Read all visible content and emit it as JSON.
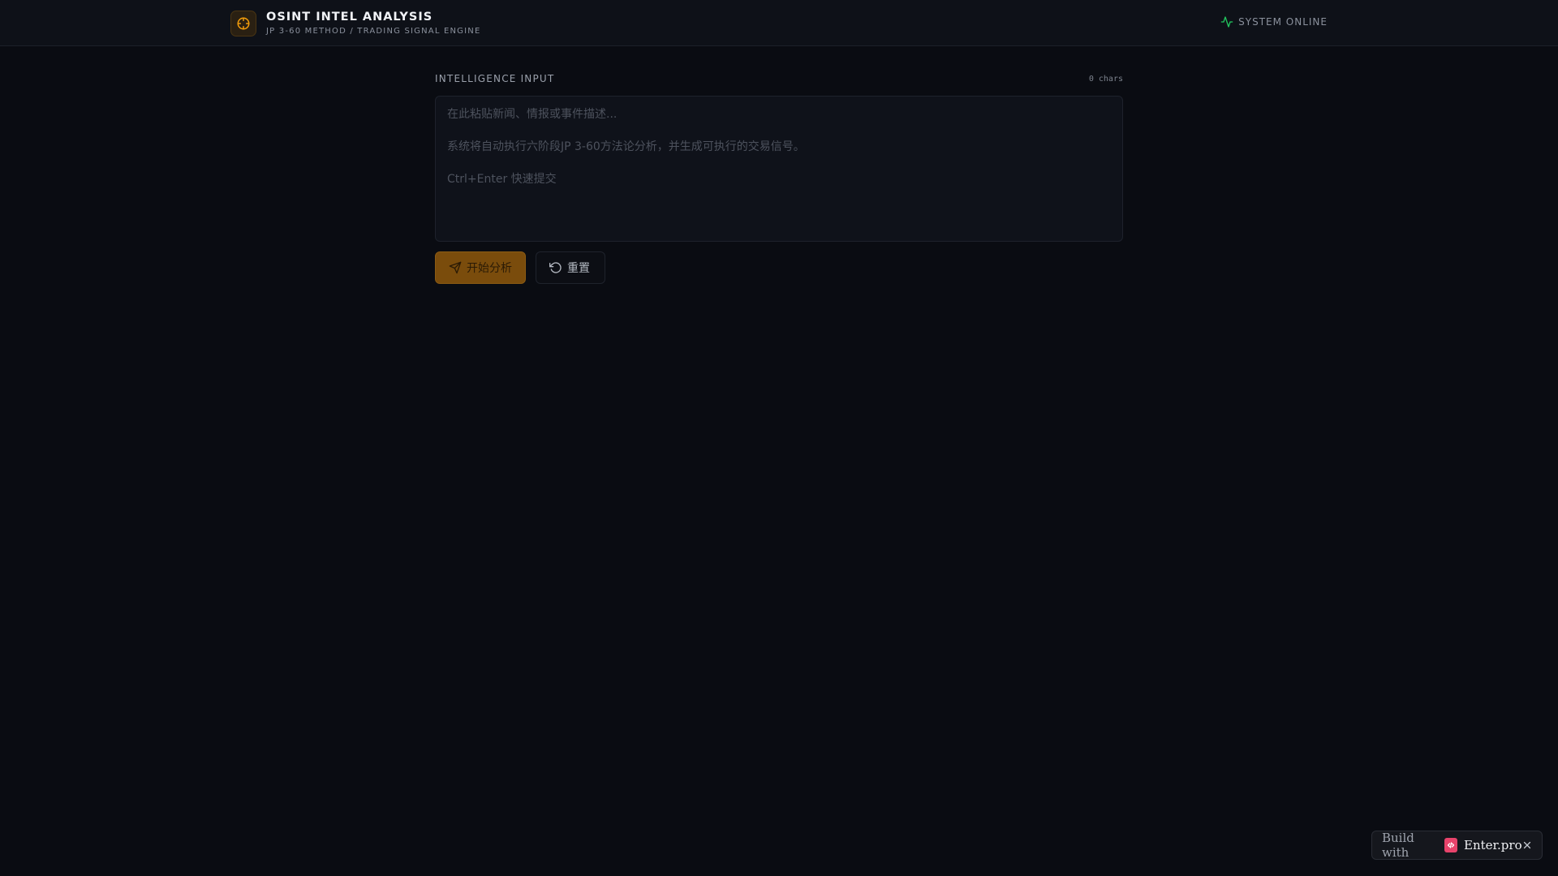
{
  "header": {
    "title": "OSINT INTEL ANALYSIS",
    "subtitle": "JP 3-60 METHOD / TRADING SIGNAL ENGINE",
    "logo_icon": "crosshair-icon",
    "status_text": "SYSTEM ONLINE",
    "status_icon": "activity-icon",
    "status_color": "#22c55e",
    "accent_color": "#f59e0b"
  },
  "input": {
    "label": "INTELLIGENCE INPUT",
    "char_count": "0 chars",
    "value": "",
    "placeholder": "在此粘贴新闻、情报或事件描述...\n\n系统将自动执行六阶段JP 3-60方法论分析，并生成可执行的交易信号。\n\nCtrl+Enter 快速提交"
  },
  "actions": {
    "analyze_label": "开始分析",
    "analyze_icon": "send-icon",
    "reset_label": "重置",
    "reset_icon": "rotate-ccw-icon"
  },
  "badge": {
    "prefix": "Build with",
    "name": "Enter.pro",
    "logo_icon": "code-icon",
    "close_icon": "close-icon",
    "brand_color": "#e8436b"
  }
}
